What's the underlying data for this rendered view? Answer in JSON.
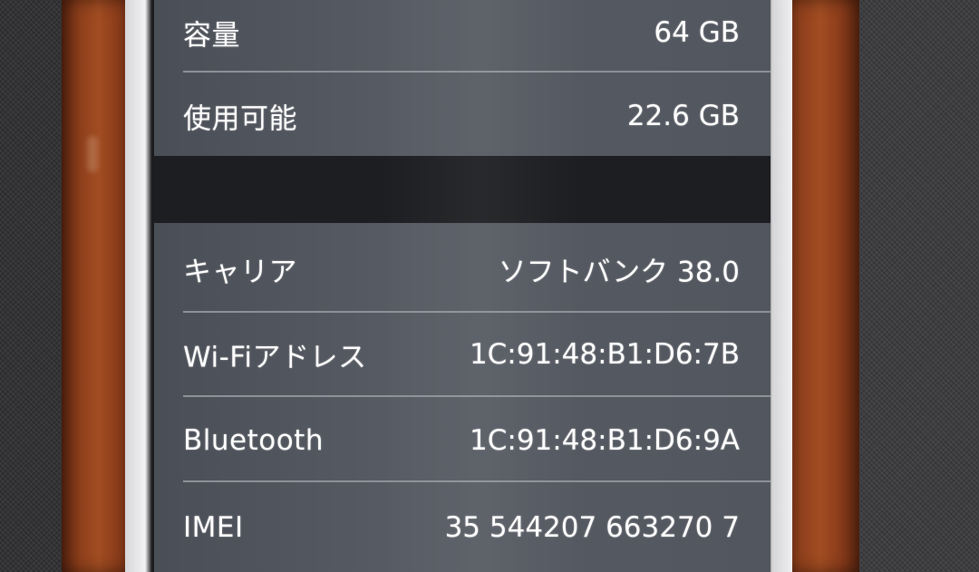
{
  "storage": {
    "capacity": {
      "label": "容量",
      "value": "64 GB"
    },
    "available": {
      "label": "使用可能",
      "value": "22.6 GB"
    }
  },
  "network": {
    "carrier": {
      "label": "キャリア",
      "value": "ソフトバンク 38.0"
    },
    "wifi": {
      "label": "Wi-Fiアドレス",
      "value": "1C:91:48:B1:D6:7B"
    },
    "bluetooth": {
      "label": "Bluetooth",
      "value": "1C:91:48:B1:D6:9A"
    },
    "imei": {
      "label": "IMEI",
      "value": "35 544207 663270 7"
    }
  },
  "colors": {
    "row_background": "#52565e",
    "section_gap": "#1d1e21",
    "text": "#ffffff",
    "divider": "#8e9198",
    "case_leather": "#8d3f1b"
  }
}
